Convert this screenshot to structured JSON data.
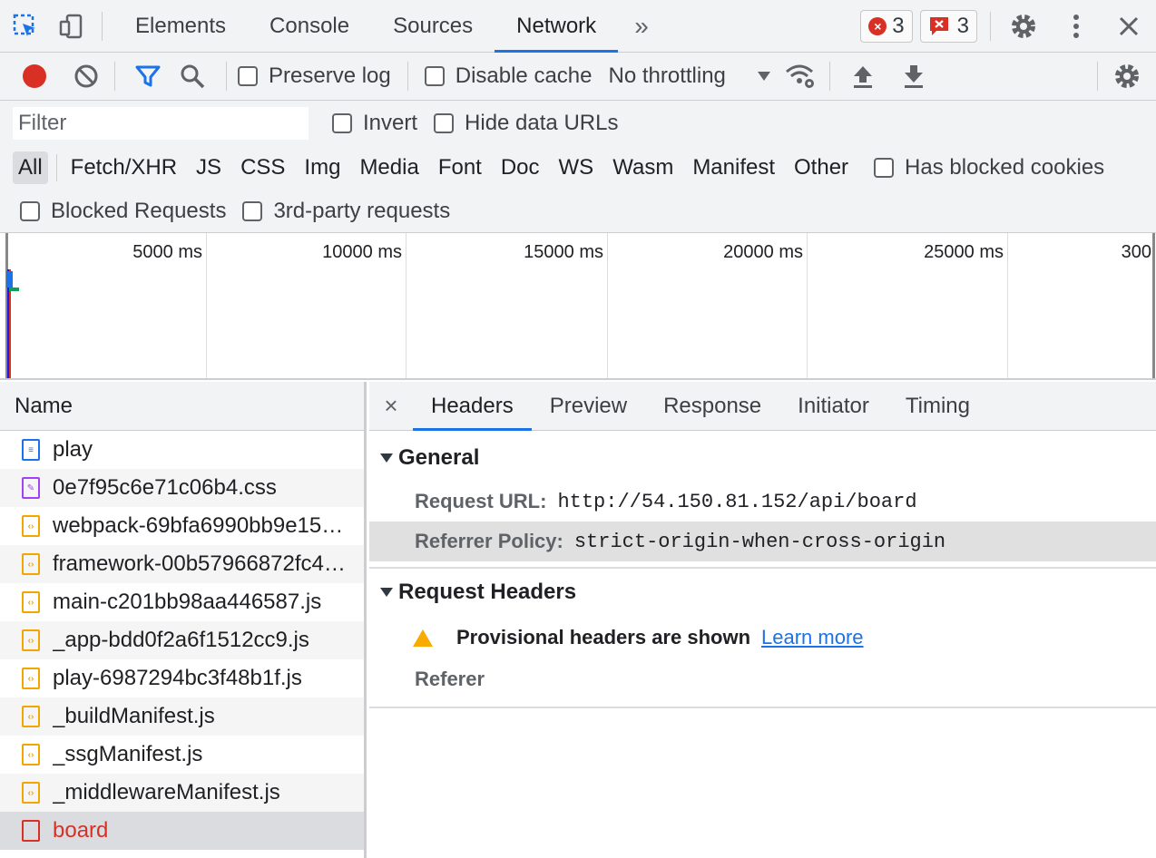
{
  "topbar": {
    "tabs": [
      {
        "label": "Elements"
      },
      {
        "label": "Console"
      },
      {
        "label": "Sources"
      },
      {
        "label": "Network",
        "active": true
      }
    ],
    "more_tabs_glyph": "»",
    "error_count": "3",
    "issue_count": "3",
    "icons": [
      "inspect-icon",
      "device-toggle-icon",
      "settings-icon",
      "more-vert-icon",
      "close-icon"
    ]
  },
  "toolbar": {
    "preserve_log_label": "Preserve log",
    "disable_cache_label": "Disable cache",
    "throttling_value": "No throttling",
    "icons": [
      "record-icon",
      "clear-icon",
      "filter-icon",
      "search-icon",
      "network-conditions-icon",
      "upload-icon",
      "download-icon",
      "settings-icon"
    ]
  },
  "filter": {
    "placeholder": "Filter",
    "invert_label": "Invert",
    "hide_data_urls_label": "Hide data URLs",
    "types": [
      "All",
      "Fetch/XHR",
      "JS",
      "CSS",
      "Img",
      "Media",
      "Font",
      "Doc",
      "WS",
      "Wasm",
      "Manifest",
      "Other"
    ],
    "active_type": "All",
    "has_blocked_cookies_label": "Has blocked cookies",
    "blocked_requests_label": "Blocked Requests",
    "third_party_label": "3rd-party requests"
  },
  "timeline": {
    "ticks": [
      "5000 ms",
      "10000 ms",
      "15000 ms",
      "20000 ms",
      "25000 ms",
      "300"
    ]
  },
  "requests": {
    "column_name": "Name",
    "rows": [
      {
        "name": "play",
        "type": "doc"
      },
      {
        "name": "0e7f95c6e71c06b4.css",
        "type": "css"
      },
      {
        "name": "webpack-69bfa6990bb9e15…",
        "type": "js"
      },
      {
        "name": "framework-00b57966872fc4…",
        "type": "js"
      },
      {
        "name": "main-c201bb98aa446587.js",
        "type": "js"
      },
      {
        "name": "_app-bdd0f2a6f1512cc9.js",
        "type": "js"
      },
      {
        "name": "play-6987294bc3f48b1f.js",
        "type": "js"
      },
      {
        "name": "_buildManifest.js",
        "type": "js"
      },
      {
        "name": "_ssgManifest.js",
        "type": "js"
      },
      {
        "name": "_middlewareManifest.js",
        "type": "js"
      },
      {
        "name": "board",
        "type": "err",
        "selected": true
      }
    ]
  },
  "details": {
    "close_glyph": "×",
    "tabs": [
      "Headers",
      "Preview",
      "Response",
      "Initiator",
      "Timing"
    ],
    "general": {
      "title": "General",
      "request_url_key": "Request URL:",
      "request_url": "http://54.150.81.152/api/board",
      "referrer_policy_key": "Referrer Policy:",
      "referrer_policy": "strict-origin-when-cross-origin"
    },
    "request_headers": {
      "title": "Request Headers",
      "warning": "Provisional headers are shown",
      "learn_more": "Learn more",
      "referer_key": "Referer"
    }
  },
  "colors": {
    "accent": "#1a73e8",
    "error": "#d93025",
    "warning": "#f9ab00"
  }
}
